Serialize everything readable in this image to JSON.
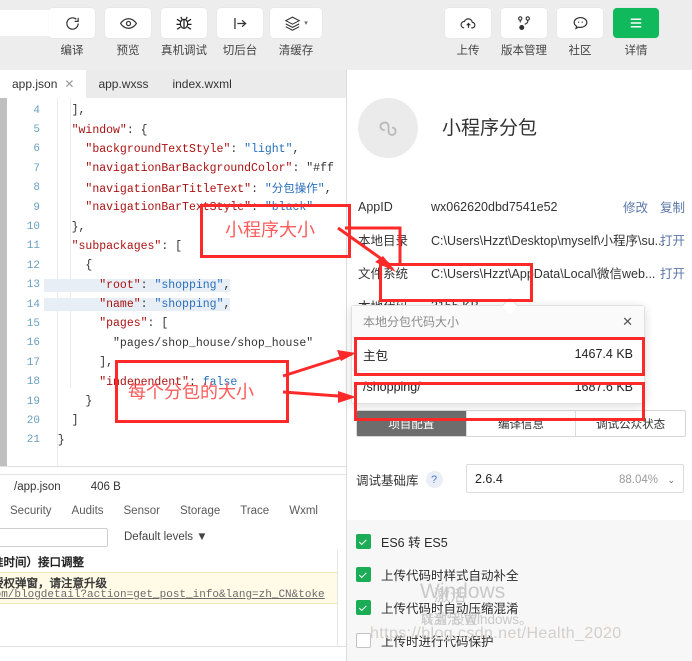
{
  "toolbar": {
    "left_items": [
      {
        "label": "编译",
        "icon": "refresh-icon"
      },
      {
        "label": "预览",
        "icon": "eye-icon"
      },
      {
        "label": "真机调试",
        "icon": "bug-icon"
      },
      {
        "label": "切后台",
        "icon": "switch-background-icon"
      },
      {
        "label": "清缓存",
        "icon": "layers-icon",
        "caret": "▾"
      }
    ],
    "right_items": [
      {
        "label": "上传",
        "icon": "upload-cloud-icon"
      },
      {
        "label": "版本管理",
        "icon": "version-branch-icon"
      },
      {
        "label": "社区",
        "icon": "chat-bubble-icon"
      },
      {
        "label": "详情",
        "icon": "menu-lines-icon",
        "active": true
      }
    ],
    "mode_select_caret": "▾",
    "accent_green": "#0fb95c"
  },
  "file_tabs": [
    {
      "label": "app.json",
      "active": true,
      "close": "✕"
    },
    {
      "label": "app.wxss",
      "active": false
    },
    {
      "label": "index.wxml",
      "active": false
    }
  ],
  "editor": {
    "lines": [
      {
        "num": "4",
        "indent": 2,
        "text": "],"
      },
      {
        "num": "5",
        "indent": 2,
        "text": "\"window\": {"
      },
      {
        "num": "6",
        "indent": 3,
        "text": "\"backgroundTextStyle\": \"light\","
      },
      {
        "num": "7",
        "indent": 3,
        "text": "\"navigationBarBackgroundColor\": \"#ff"
      },
      {
        "num": "8",
        "indent": 3,
        "text": "\"navigationBarTitleText\": \"分包操作\","
      },
      {
        "num": "9",
        "indent": 3,
        "text": "\"navigationBarTextStyle\": \"black\""
      },
      {
        "num": "10",
        "indent": 2,
        "text": "},"
      },
      {
        "num": "11",
        "indent": 2,
        "text": "\"subpackages\": ["
      },
      {
        "num": "12",
        "indent": 3,
        "text": "{"
      },
      {
        "num": "13",
        "indent": 4,
        "text": "\"root\": \"shopping\","
      },
      {
        "num": "14",
        "indent": 4,
        "text": "\"name\": \"shopping\","
      },
      {
        "num": "15",
        "indent": 4,
        "text": "\"pages\": ["
      },
      {
        "num": "16",
        "indent": 5,
        "text": "\"pages/shop_house/shop_house\""
      },
      {
        "num": "17",
        "indent": 4,
        "text": "],"
      },
      {
        "num": "18",
        "indent": 4,
        "text": "\"independent\": false"
      },
      {
        "num": "19",
        "indent": 3,
        "text": "}"
      },
      {
        "num": "20",
        "indent": 2,
        "text": "]"
      },
      {
        "num": "21",
        "indent": 1,
        "text": "}"
      }
    ]
  },
  "status_bar": {
    "file": "/app.json",
    "size": "406 B"
  },
  "devtools": {
    "tabs": [
      "Security",
      "Audits",
      "Sensor",
      "Storage",
      "Trace",
      "Wxml"
    ],
    "filter_placeholder": "",
    "levels_label": "Default levels ▼",
    "console_line_1": "准时间）接口调整",
    "console_warn_1": "授权弹窗，请注意升级",
    "console_warn_2": "com/blogdetail?action=get_post_info&lang=zh_CN&toke"
  },
  "detail": {
    "app_name": "小程序分包",
    "avatar_icon": "link-chain-icon",
    "rows": [
      {
        "label": "AppID",
        "value": "wx062620dbd7541e52",
        "actions": [
          "修改",
          "复制"
        ]
      },
      {
        "label": "本地目录",
        "value": "C:\\Users\\Hzzt\\Desktop\\myself\\小程序\\su...",
        "actions": [
          "打开"
        ]
      },
      {
        "label": "文件系统",
        "value": "C:\\Users\\Hzzt\\AppData\\Local\\微信web...",
        "actions": [
          "打开"
        ]
      },
      {
        "label": "本地代码",
        "value": "3155 KB",
        "caret": "▾",
        "actions": []
      }
    ],
    "popup": {
      "title": "本地分包代码大小",
      "close_icon": "✕",
      "packages": [
        {
          "name": "主包",
          "size": "1467.4 KB"
        },
        {
          "name": "/shopping/",
          "size": "1687.6 KB"
        }
      ]
    },
    "seg_tabs": [
      {
        "label": "项目配置",
        "active": true
      },
      {
        "label": "编译信息",
        "active": false
      },
      {
        "label": "调试公众状态",
        "active": false
      }
    ],
    "library": {
      "label": "调试基础库",
      "help_icon": "?",
      "version": "2.6.4",
      "percent": "88.04%",
      "caret": "⌄"
    },
    "checkboxes": [
      {
        "label": "ES6 转 ES5",
        "checked": true
      },
      {
        "label": "上传代码时样式自动补全",
        "checked": true
      },
      {
        "label": "上传代码时自动压缩混淆",
        "checked": true
      },
      {
        "label": "上传时进行代码保护",
        "checked": false
      }
    ]
  },
  "watermark": {
    "line1": "Windows",
    "line1_cn": "激活",
    "line2": "以激活 Windows。",
    "line2_cn": "转到\"设置\"",
    "line3": "https://blog.csdn.net/Health_2020"
  },
  "annotations": {
    "label_app_size": "小程序大小",
    "label_subpackage_size": "每个分包的大小",
    "color": "#fe2a2a",
    "text_color": "#fb5b5b"
  }
}
